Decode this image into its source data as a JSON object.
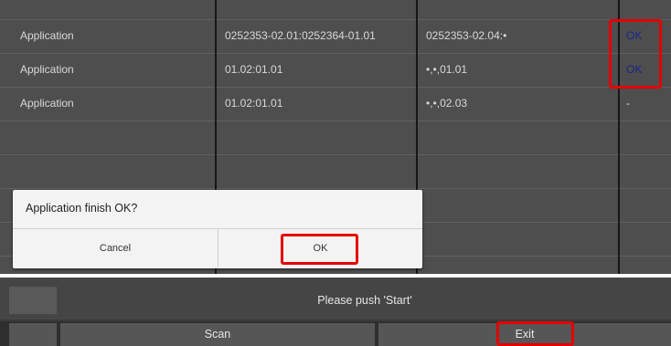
{
  "table": {
    "rows": [
      {
        "name": "Application",
        "current": "0252353-02.01:0252364-01.01",
        "target": "0252353-02.04:•",
        "result": "OK"
      },
      {
        "name": "Application",
        "current": "01.02:01.01",
        "target": "•,•,01.01",
        "result": "OK"
      },
      {
        "name": "Application",
        "current": "01.02:01.01",
        "target": "•,•,02.03",
        "result": "-"
      }
    ]
  },
  "dialog": {
    "message": "Application finish OK?",
    "cancel_label": "Cancel",
    "ok_label": "OK"
  },
  "status": {
    "text": "Please push 'Start'"
  },
  "buttons": {
    "scan_label": "Scan",
    "exit_label": "Exit"
  },
  "colors": {
    "highlight": "#e60000",
    "ok_text": "#1f2a9a"
  }
}
